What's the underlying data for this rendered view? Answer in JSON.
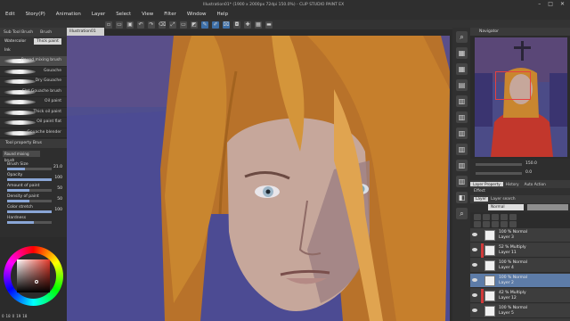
{
  "window": {
    "title": "Illustration01* (1900 x 2000px 72dpi 150.0%) - CLIP STUDIO PAINT EX",
    "controls": [
      "–",
      "□",
      "✕"
    ]
  },
  "menu": [
    "Edit",
    "Story(P)",
    "Animation",
    "Layer",
    "Select",
    "View",
    "Filter",
    "Window",
    "Help"
  ],
  "command_bar": {
    "icons": [
      "new-icon",
      "open-icon",
      "save-icon",
      "undo-icon",
      "redo-icon",
      "clear-icon",
      "transform-icon",
      "deselect-icon",
      "invert-icon",
      "pen-icon",
      "brush-icon",
      "eraser-icon",
      "mask-icon",
      "snap-icon",
      "grid-icon",
      "ruler-icon"
    ]
  },
  "tool_panel": {
    "tabs": [
      "Sub Tool Brush",
      "Brush"
    ],
    "subtabs": [
      "Watercolor",
      "Thick paint",
      "Ink",
      "Brush"
    ],
    "brushes": [
      "Round mixing brush",
      "Gouache",
      "Dry Gouache",
      "Flat Gouache brush",
      "Oil paint",
      "Thick oil paint",
      "Oil paint flat",
      "Gouache blender"
    ],
    "active_brush_index": 0
  },
  "tool_property": {
    "tab_label": "Tool property Brus",
    "preset_label": "Round mixing brush",
    "rows": [
      {
        "label": "Brush Size",
        "value": "21.0",
        "fraction": 0.4
      },
      {
        "label": "Opacity",
        "value": "100",
        "fraction": 1.0
      },
      {
        "label": "Amount of paint",
        "value": "50",
        "fraction": 0.5
      },
      {
        "label": "Density of paint",
        "value": "50",
        "fraction": 0.5
      },
      {
        "label": "Color stretch",
        "value": "100",
        "fraction": 1.0
      },
      {
        "label": "Hardness",
        "value": "",
        "fraction": 0.6
      }
    ]
  },
  "color_panel": {
    "mini_values": [
      "0",
      "18",
      "0",
      "19",
      "18"
    ]
  },
  "document": {
    "tab_label": "Illustration01"
  },
  "navigator": {
    "title": "Navigator",
    "zoom": "150.0",
    "rotation": "0.0"
  },
  "layer_panel": {
    "tabs": [
      "Layer Property",
      "History",
      "Auto Action"
    ],
    "effect_label": "Effect",
    "head_tabs": [
      "Layer",
      "Layer search"
    ],
    "blend_mode": "Normal",
    "opacity_fraction": 1.0,
    "layers": [
      {
        "mode": "100 % Normal",
        "name": "Layer 3",
        "clipped": false,
        "selected": false
      },
      {
        "mode": "52 % Multiply",
        "name": "Layer 11",
        "clipped": true,
        "selected": false
      },
      {
        "mode": "100 % Normal",
        "name": "Layer 4",
        "clipped": false,
        "selected": false
      },
      {
        "mode": "100 % Normal",
        "name": "Layer 2",
        "clipped": false,
        "selected": true
      },
      {
        "mode": "42 % Multiply",
        "name": "Layer 12",
        "clipped": true,
        "selected": false
      },
      {
        "mode": "100 % Normal",
        "name": "Layer 5",
        "clipped": false,
        "selected": false
      }
    ]
  },
  "colors": {
    "canvas_bg": "#4f4e8e",
    "hair": "#c9862f",
    "skin": "#c8aaa0",
    "selection": "#5d7ca8",
    "clip": "#d23a3a"
  }
}
